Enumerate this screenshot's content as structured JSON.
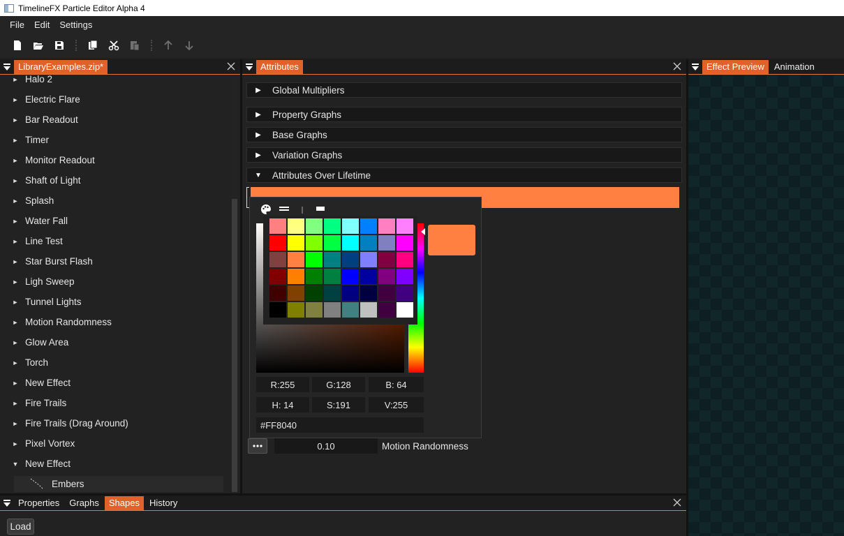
{
  "window": {
    "title": "TimelineFX Particle Editor Alpha 4"
  },
  "menu": {
    "items": [
      "File",
      "Edit",
      "Settings"
    ]
  },
  "toolbar": {
    "buttons": [
      "new-file-icon",
      "open-folder-icon",
      "save-icon",
      "copy-icon",
      "cut-icon",
      "paste-icon",
      "arrow-up-icon",
      "arrow-down-icon"
    ]
  },
  "library": {
    "tab_label": "LibraryExamples.zip*",
    "partial_item": "Halo 2",
    "items": [
      "Electric Flare",
      "Bar Readout",
      "Timer",
      "Monitor Readout",
      "Shaft of Light",
      "Splash",
      "Water Fall",
      "Line Test",
      "Star Burst Flash",
      "Ligh Sweep",
      "Tunnel Lights",
      "Motion Randomness",
      "Glow Area",
      "Torch",
      "New Effect",
      "Fire Trails",
      "Fire Trails (Drag Around)",
      "Pixel Vortex",
      "New Effect"
    ],
    "expanded_child": "Embers"
  },
  "attributes": {
    "tab_label": "Attributes",
    "sections": [
      {
        "label": "Global Multipliers",
        "expanded": false
      },
      {
        "label": "Property Graphs",
        "expanded": false
      },
      {
        "label": "Base Graphs",
        "expanded": false
      },
      {
        "label": "Variation Graphs",
        "expanded": false
      },
      {
        "label": "Attributes Over Lifetime",
        "expanded": true
      }
    ],
    "color_value": "#FF8040",
    "motion_value": "0.10",
    "motion_label": "Motion Randomness"
  },
  "color_picker": {
    "swatches": [
      "#ff8080",
      "#ffff80",
      "#80ff80",
      "#00ff80",
      "#80ffff",
      "#0080ff",
      "#ff80c0",
      "#ff80ff",
      "#ff0000",
      "#ffff00",
      "#80ff00",
      "#00ff40",
      "#00ffff",
      "#0080c0",
      "#8080c0",
      "#ff00ff",
      "#804040",
      "#ff8040",
      "#00ff00",
      "#008080",
      "#004080",
      "#8080ff",
      "#800040",
      "#ff0080",
      "#800000",
      "#ff8000",
      "#008000",
      "#008040",
      "#0000ff",
      "#0000a0",
      "#800080",
      "#8000ff",
      "#400000",
      "#804000",
      "#004000",
      "#004040",
      "#000080",
      "#000040",
      "#400040",
      "#400080",
      "#000000",
      "#808000",
      "#808040",
      "#808080",
      "#408080",
      "#c0c0c0",
      "#400040",
      "#ffffff"
    ],
    "r": "R:255",
    "g": "G:128",
    "b": "B: 64",
    "h": "H: 14",
    "s": "S:191",
    "v": "V:255",
    "hex": "#FF8040",
    "current_color": "#ff8040"
  },
  "preview": {
    "tabs": [
      "Effect Preview",
      "Animation"
    ]
  },
  "bottom": {
    "tabs": [
      "Properties",
      "Graphs",
      "Shapes",
      "History"
    ],
    "active_tab": "Shapes",
    "load_label": "Load"
  },
  "colors": {
    "accent": "#e0622a",
    "panel_bg": "#222222",
    "selected_color": "#ff8040"
  }
}
